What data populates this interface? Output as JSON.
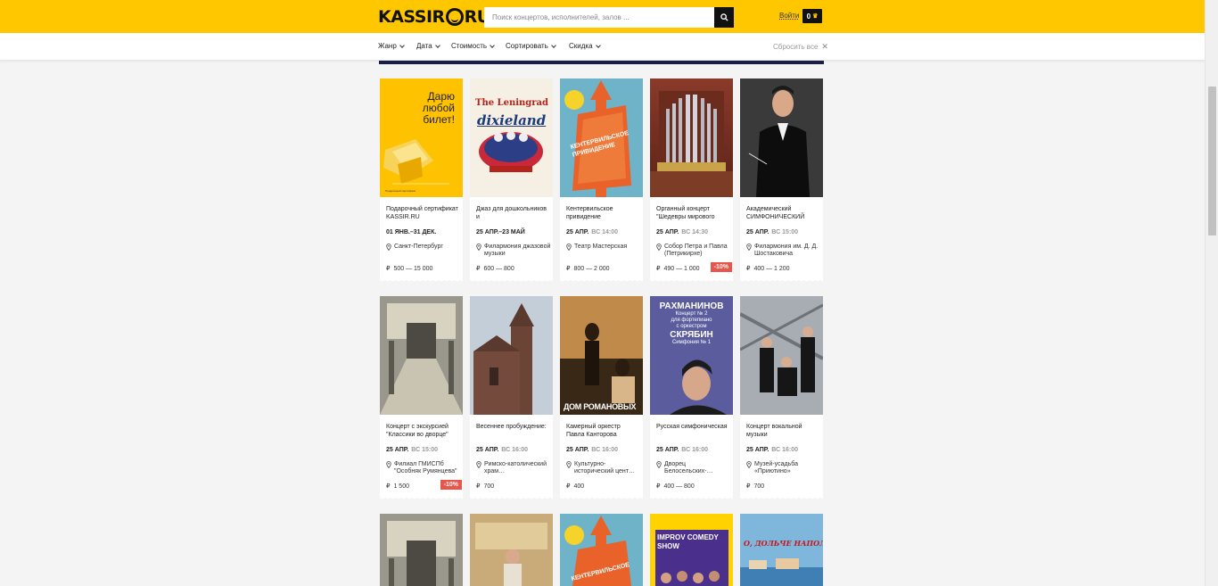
{
  "header": {
    "logo_text_left": "KASSIR",
    "logo_text_right": "RU",
    "search_placeholder": "Поиск концертов, исполнителей, залов ...",
    "login": "Войти",
    "cart_count": "0"
  },
  "filters": {
    "items": [
      "Жанр",
      "Дата",
      "Стоимость",
      "Сортировать",
      "Скидка"
    ],
    "reset": "Сбросить все"
  },
  "currency_symbol": "₽",
  "cards": [
    {
      "title": "Подарочный сертификат KASSIR.RU",
      "date": "01 ЯНВ.–31 ДЕК.",
      "time": "",
      "venue": "Санкт-Петербург",
      "price": "500 — 15 000",
      "discount": ""
    },
    {
      "title": "Джаз для дошкольников и",
      "date": "25 АПР.–23 МАЙ",
      "time": "",
      "venue": "Филармония джазовой музыки",
      "price": "600 — 800",
      "discount": ""
    },
    {
      "title": "Кентервильское привидение",
      "date": "25 АПР.",
      "time": "ВС 14:00",
      "venue": "Театр Мастерская",
      "price": "800 — 2 000",
      "discount": ""
    },
    {
      "title": "Органный концерт \"Шедевры мирового",
      "date": "25 АПР.",
      "time": "ВС 14:30",
      "venue": "Собор Петра и Павла (Петрикирхе)",
      "price": "490 — 1 000",
      "discount": "-10%"
    },
    {
      "title": "Академический СИМФОНИЧЕСКИЙ",
      "date": "25 АПР.",
      "time": "ВС 15:00",
      "venue": "Филармония им. Д. Д. Шостаковича",
      "price": "400 — 1 200",
      "discount": ""
    },
    {
      "title": "Концерт с экскурсией \"Классики во дворце\"",
      "date": "25 АПР.",
      "time": "ВС 15:00",
      "venue": "Филиал ГМИСПб \"Особняк Румянцева\"",
      "price": "1 500",
      "discount": "-10%"
    },
    {
      "title": "Весеннее пробуждение:",
      "date": "25 АПР.",
      "time": "ВС 16:00",
      "venue": "Римско-католический храм…",
      "price": "700",
      "discount": ""
    },
    {
      "title": "Камерный оркестр Павла Канторова",
      "date": "25 АПР.",
      "time": "ВС 16:00",
      "venue": "Культурно-исторический цент…",
      "price": "400",
      "discount": ""
    },
    {
      "title": "Русская симфоническая",
      "date": "25 АПР.",
      "time": "ВС 16:00",
      "venue": "Дворец Белосельских-…",
      "price": "400 — 800",
      "discount": ""
    },
    {
      "title": "Концерт вокальной музыки",
      "date": "25 АПР.",
      "time": "ВС 16:00",
      "venue": "Музей-усадьба «Приютино»",
      "price": "700",
      "discount": ""
    }
  ],
  "poster_texts": {
    "gift": [
      "Дарю",
      "любой",
      "билет!"
    ],
    "gift_footer": "Подарочный сертификат",
    "leningrad": "The Leningrad",
    "dixie": "dixieland",
    "canterville": [
      "КЕНТЕРВИЛЬСКОЕ",
      "ПРИВИДЕНИЕ"
    ],
    "rach_name": "РАХМАНИНОВ",
    "rach_sub": [
      "Концерт № 2",
      "для фортепиано",
      "с оркестром"
    ],
    "scriabin": "СКРЯБИН",
    "scriabin_sub": "Симфония № 1",
    "romanov": "ДОМ РОМАНОВЫХ",
    "improv": [
      "IMPROV COMEDY",
      "SHOW"
    ],
    "napoli": "О, ДОЛЬЧЕ НАПОЛИ !"
  }
}
